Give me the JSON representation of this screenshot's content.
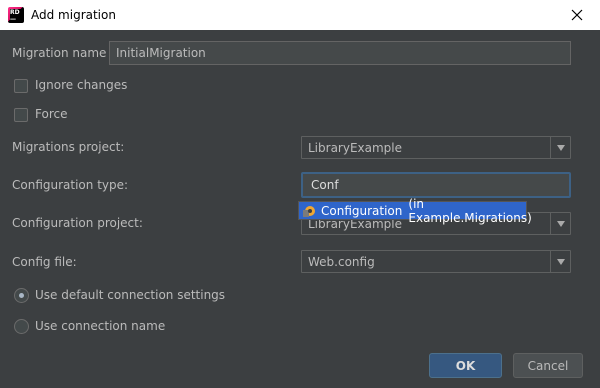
{
  "window": {
    "title": "Add migration",
    "app_icon": "rider-icon"
  },
  "form": {
    "migration_name_label": "Migration name",
    "migration_name_value": "InitialMigration",
    "ignore_changes_label": "Ignore changes",
    "force_label": "Force",
    "migrations_project_label": "Migrations project:",
    "migrations_project_value": "LibraryExample",
    "configuration_type_label": "Configuration type:",
    "configuration_type_value": "Conf",
    "configuration_project_label": "Configuration project:",
    "configuration_project_value": "LibraryExample",
    "config_file_label": "Config file:",
    "config_file_value": "Web.config",
    "use_default_connection_label": "Use default connection settings",
    "use_connection_name_label": "Use connection name"
  },
  "autocomplete": {
    "item_name": "Configuration",
    "item_location": "(in Example.Migrations)"
  },
  "buttons": {
    "ok": "OK",
    "cancel": "Cancel"
  },
  "state": {
    "ignore_changes_checked": false,
    "force_checked": false,
    "selected_connection_option": "use_default_connection"
  },
  "colors": {
    "background": "#3c3f41",
    "selection": "#2f65ca",
    "focus_border": "#3d6185",
    "ok_button": "#365880"
  }
}
